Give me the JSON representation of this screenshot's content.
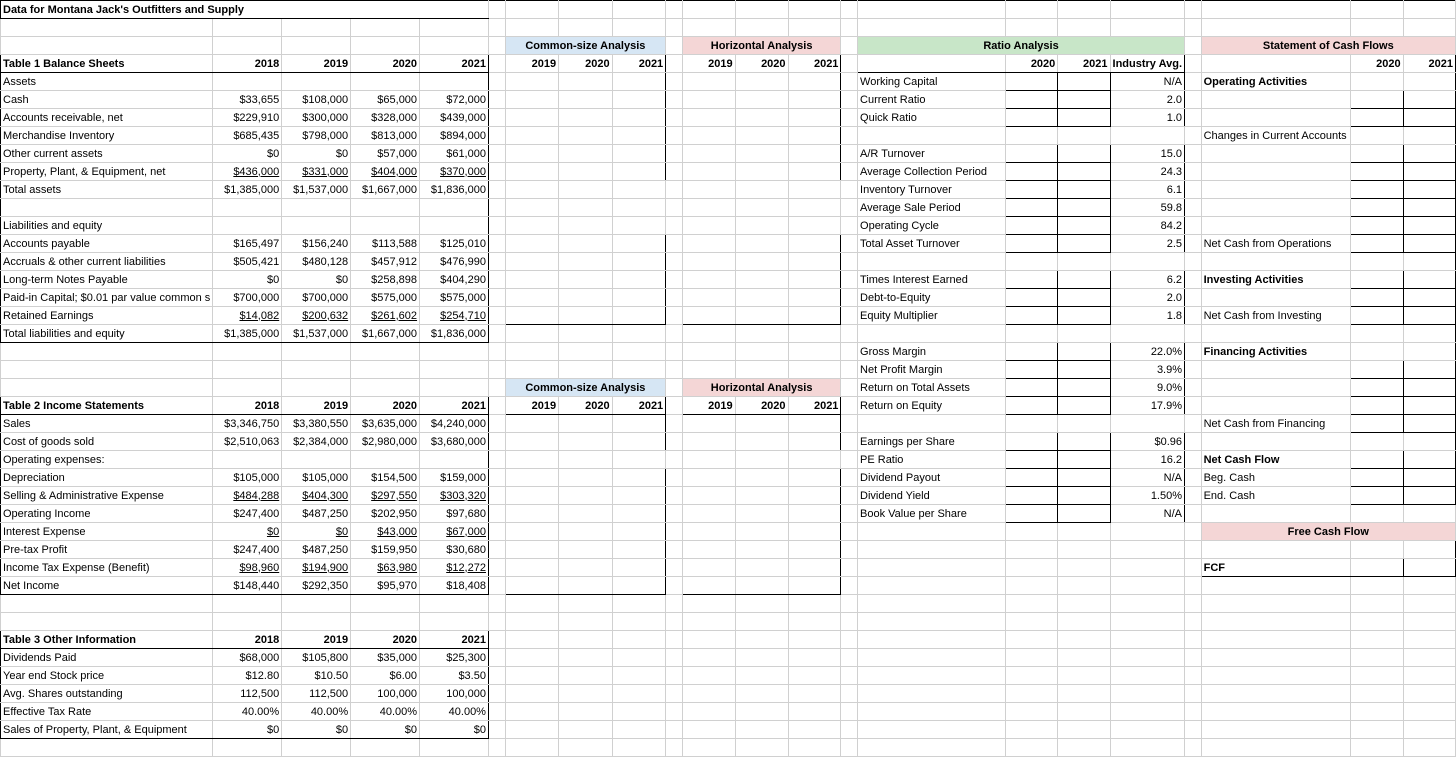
{
  "title": "Data for Montana Jack's Outfitters and Supply",
  "years": [
    "2018",
    "2019",
    "2020",
    "2021"
  ],
  "sections": {
    "common": "Common-size Analysis",
    "horizontal": "Horizontal Analysis",
    "ratio": "Ratio Analysis",
    "cashflow": "Statement of Cash Flows",
    "freecash": "Free Cash Flow"
  },
  "subyears3": [
    "2019",
    "2020",
    "2021"
  ],
  "subyears2": [
    "2020",
    "2021"
  ],
  "industryAvgLabel": "Industry Avg.",
  "table1": {
    "title": "Table 1   Balance Sheets",
    "groups": {
      "assets": "Assets",
      "liab": "Liabilities and equity"
    },
    "rows": [
      {
        "k": "cash",
        "lbl": "  Cash",
        "indent": 1,
        "v": [
          "$33,655",
          "$108,000",
          "$65,000",
          "$72,000"
        ]
      },
      {
        "k": "ar",
        "lbl": "  Accounts receivable, net",
        "indent": 1,
        "v": [
          "$229,910",
          "$300,000",
          "$328,000",
          "$439,000"
        ]
      },
      {
        "k": "inv",
        "lbl": "  Merchandise Inventory",
        "indent": 1,
        "v": [
          "$685,435",
          "$798,000",
          "$813,000",
          "$894,000"
        ]
      },
      {
        "k": "oca",
        "lbl": "  Other current assets",
        "indent": 1,
        "v": [
          "$0",
          "$0",
          "$57,000",
          "$61,000"
        ]
      },
      {
        "k": "ppe",
        "lbl": "  Property, Plant, & Equipment, net",
        "indent": 1,
        "v": [
          "$436,000",
          "$331,000",
          "$404,000",
          "$370,000"
        ],
        "u": true,
        "italic": "net"
      },
      {
        "k": "ta",
        "lbl": "Total assets",
        "indent": 0,
        "v": [
          "$1,385,000",
          "$1,537,000",
          "$1,667,000",
          "$1,836,000"
        ]
      }
    ],
    "rows2": [
      {
        "k": "ap",
        "lbl": "  Accounts payable",
        "indent": 1,
        "v": [
          "$165,497",
          "$156,240",
          "$113,588",
          "$125,010"
        ]
      },
      {
        "k": "acc",
        "lbl": "  Accruals & other current liabilities",
        "indent": 1,
        "v": [
          "$505,421",
          "$480,128",
          "$457,912",
          "$476,990"
        ]
      },
      {
        "k": "ltn",
        "lbl": "  Long-term Notes Payable",
        "indent": 1,
        "v": [
          "$0",
          "$0",
          "$258,898",
          "$404,290"
        ]
      },
      {
        "k": "pic",
        "lbl": "  Paid-in Capital; $0.01 par value common s",
        "indent": 1,
        "v": [
          "$700,000",
          "$700,000",
          "$575,000",
          "$575,000"
        ]
      },
      {
        "k": "re",
        "lbl": "  Retained Earnings",
        "indent": 1,
        "v": [
          "$14,082",
          "$200,632",
          "$261,602",
          "$254,710"
        ],
        "u": true
      },
      {
        "k": "tle",
        "lbl": "Total liabilities and equity",
        "indent": 0,
        "v": [
          "$1,385,000",
          "$1,537,000",
          "$1,667,000",
          "$1,836,000"
        ]
      }
    ]
  },
  "table2": {
    "title": "Table 2   Income Statements",
    "rows": [
      {
        "k": "sales",
        "lbl": "Sales",
        "v": [
          "$3,346,750",
          "$3,380,550",
          "$3,635,000",
          "$4,240,000"
        ]
      },
      {
        "k": "cogs",
        "lbl": "Cost of goods sold",
        "v": [
          "$2,510,063",
          "$2,384,000",
          "$2,980,000",
          "$3,680,000"
        ]
      },
      {
        "k": "opexhdr",
        "lbl": "Operating expenses:",
        "v": [
          "",
          "",
          "",
          ""
        ]
      },
      {
        "k": "dep",
        "lbl": "  Depreciation",
        "v": [
          "$105,000",
          "$105,000",
          "$154,500",
          "$159,000"
        ]
      },
      {
        "k": "sga",
        "lbl": "  Selling & Administrative Expense",
        "v": [
          "$484,288",
          "$404,300",
          "$297,550",
          "$303,320"
        ],
        "u": true
      },
      {
        "k": "opinc",
        "lbl": "Operating Income",
        "v": [
          "$247,400",
          "$487,250",
          "$202,950",
          "$97,680"
        ]
      },
      {
        "k": "intexp",
        "lbl": "Interest Expense",
        "v": [
          "$0",
          "$0",
          "$43,000",
          "$67,000"
        ],
        "u": true
      },
      {
        "k": "pretax",
        "lbl": "Pre-tax Profit",
        "v": [
          "$247,400",
          "$487,250",
          "$159,950",
          "$30,680"
        ]
      },
      {
        "k": "tax",
        "lbl": "Income Tax Expense (Benefit)",
        "v": [
          "$98,960",
          "$194,900",
          "$63,980",
          "$12,272"
        ],
        "u": true
      },
      {
        "k": "ni",
        "lbl": "Net Income",
        "v": [
          "$148,440",
          "$292,350",
          "$95,970",
          "$18,408"
        ]
      }
    ]
  },
  "table3": {
    "title": "Table 3   Other Information",
    "rows": [
      {
        "k": "div",
        "lbl": "Dividends Paid",
        "v": [
          "$68,000",
          "$105,800",
          "$35,000",
          "$25,300"
        ]
      },
      {
        "k": "price",
        "lbl": "Year end Stock price",
        "v": [
          "$12.80",
          "$10.50",
          "$6.00",
          "$3.50"
        ]
      },
      {
        "k": "shares",
        "lbl": "Avg. Shares outstanding",
        "v": [
          "112,500",
          "112,500",
          "100,000",
          "100,000"
        ]
      },
      {
        "k": "etr",
        "lbl": "Effective Tax Rate",
        "v": [
          "40.00%",
          "40.00%",
          "40.00%",
          "40.00%"
        ]
      },
      {
        "k": "saleppe",
        "lbl": "Sales of Property, Plant, & Equipment",
        "v": [
          "$0",
          "$0",
          "$0",
          "$0"
        ]
      }
    ]
  },
  "ratios": [
    {
      "k": "wc",
      "lbl": "Working Capital",
      "avg": "N/A"
    },
    {
      "k": "cr",
      "lbl": "Current Ratio",
      "avg": "2.0"
    },
    {
      "k": "qr",
      "lbl": "Quick Ratio",
      "avg": "1.0"
    },
    {
      "gap": true
    },
    {
      "k": "art",
      "lbl": "A/R Turnover",
      "avg": "15.0"
    },
    {
      "k": "acp",
      "lbl": "Average Collection Period",
      "avg": "24.3"
    },
    {
      "k": "it",
      "lbl": "Inventory Turnover",
      "avg": "6.1"
    },
    {
      "k": "asp",
      "lbl": "Average Sale Period",
      "avg": "59.8"
    },
    {
      "k": "oc",
      "lbl": "Operating Cycle",
      "avg": "84.2"
    },
    {
      "k": "tat",
      "lbl": "Total Asset Turnover",
      "avg": "2.5"
    },
    {
      "gap": true
    },
    {
      "k": "tie",
      "lbl": "Times Interest Earned",
      "avg": "6.2"
    },
    {
      "k": "de",
      "lbl": "Debt-to-Equity",
      "avg": "2.0"
    },
    {
      "k": "em",
      "lbl": "Equity Multiplier",
      "avg": "1.8"
    },
    {
      "gap": true
    },
    {
      "k": "gm",
      "lbl": "Gross Margin",
      "avg": "22.0%"
    },
    {
      "k": "npm",
      "lbl": "Net Profit Margin",
      "avg": "3.9%"
    },
    {
      "k": "roa",
      "lbl": "Return on Total Assets",
      "avg": "9.0%"
    },
    {
      "k": "roe",
      "lbl": "Return on Equity",
      "avg": "17.9%"
    },
    {
      "gap": true
    },
    {
      "k": "eps",
      "lbl": "Earnings per Share",
      "avg": "$0.96"
    },
    {
      "k": "pe",
      "lbl": "PE Ratio",
      "avg": "16.2"
    },
    {
      "k": "dp",
      "lbl": "Dividend Payout",
      "avg": "N/A"
    },
    {
      "k": "dy",
      "lbl": "Dividend Yield",
      "avg": "1.50%"
    },
    {
      "k": "bvps",
      "lbl": "Book Value per Share",
      "avg": "N/A"
    }
  ],
  "cashflow": {
    "op": "Operating Activities",
    "chg": "Changes in Current Accounts",
    "ncfo": "Net Cash from Operations",
    "inv": "Investing Activities",
    "ncfi": "Net Cash from Investing",
    "fin": "Financing Activities",
    "ncff": "Net Cash from Financing",
    "ncf": "Net Cash Flow",
    "begc": "Beg. Cash",
    "endc": "End. Cash",
    "fcf": "FCF"
  }
}
